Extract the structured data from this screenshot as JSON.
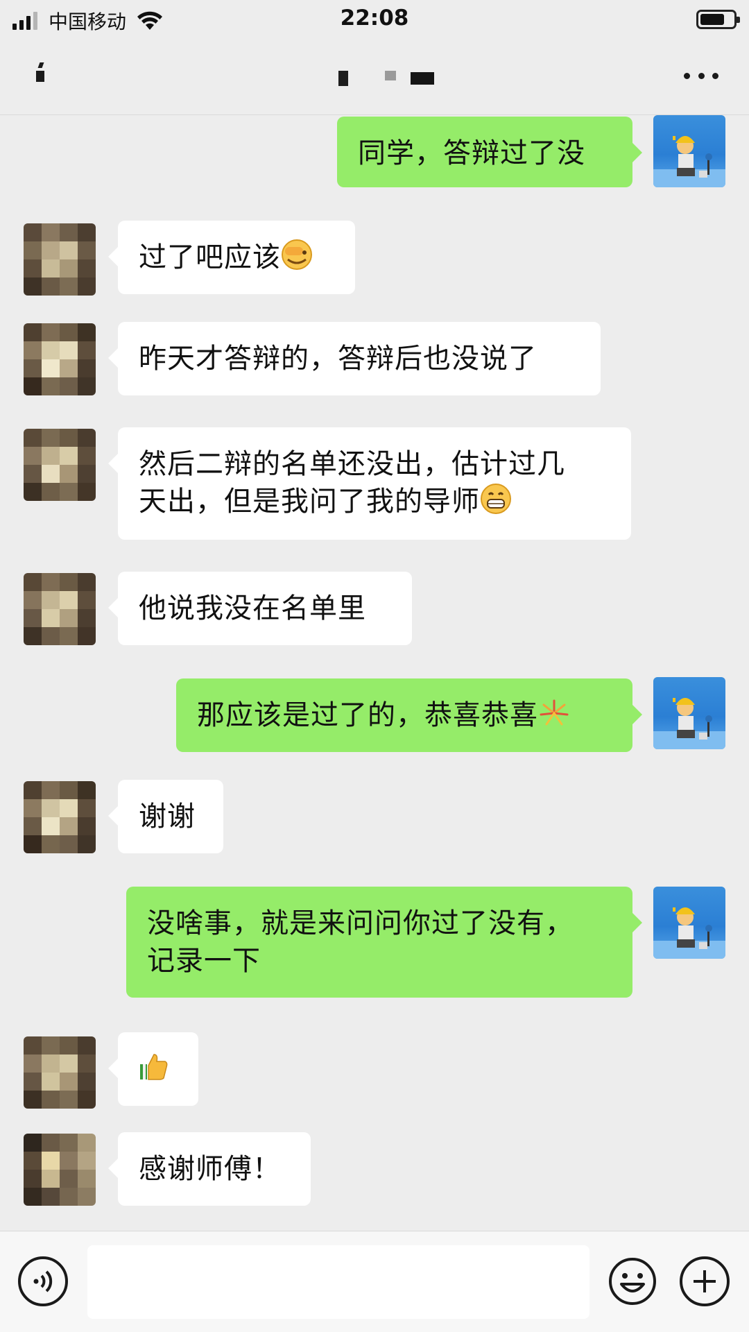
{
  "status": {
    "carrier": "中国移动",
    "time": "22:08"
  },
  "colors": {
    "background": "#ededed",
    "bubble_self": "#95ec69",
    "bubble_other": "#ffffff"
  },
  "messages": [
    {
      "side": "right",
      "text": "同学，答辩过了没"
    },
    {
      "side": "left",
      "text": "过了吧应该",
      "emoji": "facepalm-emoji"
    },
    {
      "side": "left",
      "text": "昨天才答辩的，答辩后也没说了"
    },
    {
      "side": "left",
      "line1": "然后二辩的名单还没出，估计过几",
      "line2": "天出，但是我问了我的导师",
      "emoji": "grin-emoji"
    },
    {
      "side": "left",
      "text": "他说我没在名单里"
    },
    {
      "side": "right",
      "text": "那应该是过了的，恭喜恭喜",
      "emoji": "fireworks-emoji"
    },
    {
      "side": "left",
      "text": "谢谢"
    },
    {
      "side": "right",
      "line1": "没啥事，就是来问问你过了没有，",
      "line2": "记录一下"
    },
    {
      "side": "left",
      "text": "",
      "emoji": "thumbs-up-emoji"
    },
    {
      "side": "left",
      "text": "感谢师傅！"
    }
  ],
  "icons": [
    "voice-icon",
    "emoji-icon",
    "plus-icon",
    "more-icon"
  ]
}
